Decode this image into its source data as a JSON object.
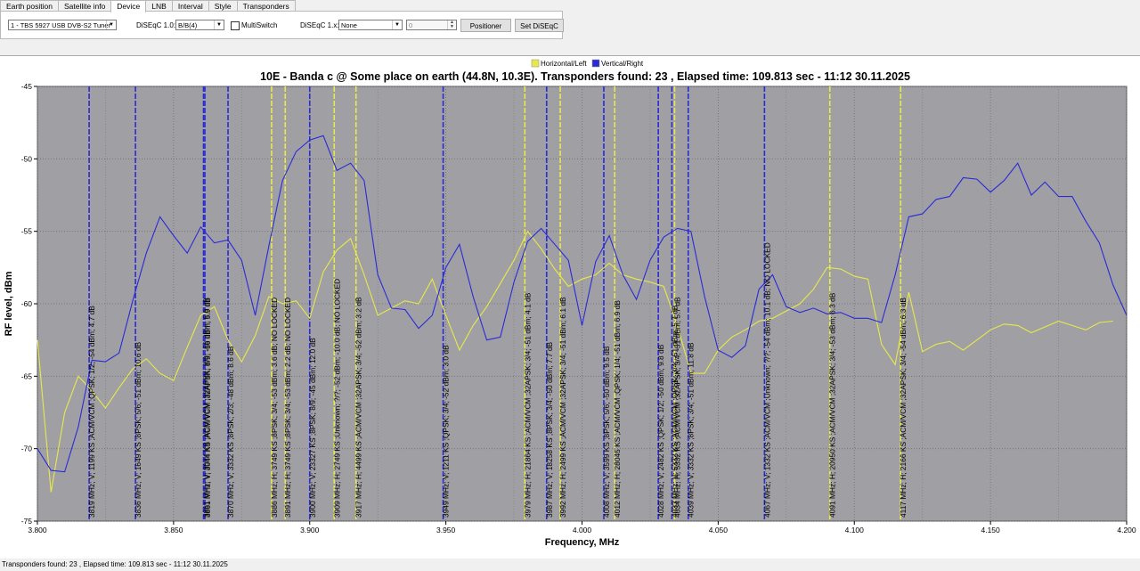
{
  "tabs": [
    {
      "label": "Earth position",
      "active": false
    },
    {
      "label": "Satellite info",
      "active": false
    },
    {
      "label": "Device",
      "active": true
    },
    {
      "label": "LNB",
      "active": false
    },
    {
      "label": "Interval",
      "active": false
    },
    {
      "label": "Style",
      "active": false
    },
    {
      "label": "Transponders",
      "active": false
    }
  ],
  "device": {
    "tuner_value": "1 - TBS 5927 USB DVB-S2 Tuner",
    "diseqc10_label": "DiSEqC 1.0:",
    "diseqc10_value": "B/B(4)",
    "multiswitch_label": "MultiSwitch",
    "diseqc1x_label": "DiSEqC 1.x:",
    "diseqc1x_value": "None",
    "spin_value": "0",
    "positioner_label": "Positioner",
    "set_diseqc_label": "Set DiSEqC"
  },
  "chart": {
    "legend_h": "Horizontal/Left",
    "legend_v": "Vertical/Right",
    "title": "10E - Banda c @ Some place on earth (44.8N, 10.3E). Transponders found: 23 , Elapsed time: 109.813 sec - 11:12 30.11.2025",
    "ylabel": "RF level, dBm",
    "xlabel": "Frequency, MHz",
    "color_h": "#e8e84a",
    "color_v": "#2a2ad8",
    "bg": "#a0a0a4"
  },
  "chart_data": {
    "type": "line",
    "title": "10E - Banda c @ Some place on earth (44.8N, 10.3E). Transponders found: 23 , Elapsed time: 109.813 sec - 11:12 30.11.2025",
    "xlabel": "Frequency, MHz",
    "ylabel": "RF level, dBm",
    "xlim": [
      3.8,
      4.2
    ],
    "ylim": [
      -75,
      -45
    ],
    "xticks": [
      "3.800",
      "3.850",
      "3.900",
      "3.950",
      "4.000",
      "4.050",
      "4.100",
      "4.150",
      "4.200"
    ],
    "yticks": [
      "-45",
      "-50",
      "-55",
      "-60",
      "-65",
      "-70",
      "-75"
    ],
    "legend": "top-right",
    "grid": true,
    "series": [
      {
        "name": "Horizontal/Left",
        "color": "#e8e84a",
        "points": [
          [
            3.8,
            -62.5
          ],
          [
            3.805,
            -73
          ],
          [
            3.81,
            -67.5
          ],
          [
            3.815,
            -65
          ],
          [
            3.82,
            -66
          ],
          [
            3.825,
            -67.2
          ],
          [
            3.83,
            -65.8
          ],
          [
            3.835,
            -64.5
          ],
          [
            3.84,
            -63.8
          ],
          [
            3.845,
            -64.8
          ],
          [
            3.85,
            -65.3
          ],
          [
            3.855,
            -63
          ],
          [
            3.86,
            -60.8
          ],
          [
            3.865,
            -60.2
          ],
          [
            3.87,
            -62.5
          ],
          [
            3.875,
            -64
          ],
          [
            3.88,
            -62.2
          ],
          [
            3.885,
            -59.5
          ],
          [
            3.89,
            -60
          ],
          [
            3.895,
            -59.8
          ],
          [
            3.9,
            -61
          ],
          [
            3.905,
            -57.8
          ],
          [
            3.91,
            -56.3
          ],
          [
            3.915,
            -55.5
          ],
          [
            3.92,
            -58
          ],
          [
            3.925,
            -60.8
          ],
          [
            3.93,
            -60.3
          ],
          [
            3.935,
            -59.8
          ],
          [
            3.94,
            -60
          ],
          [
            3.945,
            -58.3
          ],
          [
            3.95,
            -60.8
          ],
          [
            3.955,
            -63.2
          ],
          [
            3.96,
            -61.5
          ],
          [
            3.965,
            -60.2
          ],
          [
            3.97,
            -58.6
          ],
          [
            3.975,
            -57
          ],
          [
            3.98,
            -55
          ],
          [
            3.985,
            -56.2
          ],
          [
            3.99,
            -57.6
          ],
          [
            3.995,
            -58.8
          ],
          [
            4.0,
            -58.3
          ],
          [
            4.005,
            -58
          ],
          [
            4.01,
            -57.2
          ],
          [
            4.015,
            -58
          ],
          [
            4.02,
            -58.3
          ],
          [
            4.025,
            -58.5
          ],
          [
            4.03,
            -58.8
          ],
          [
            4.035,
            -61.5
          ],
          [
            4.04,
            -64.8
          ],
          [
            4.045,
            -64.8
          ],
          [
            4.05,
            -63.2
          ],
          [
            4.055,
            -62.3
          ],
          [
            4.06,
            -61.8
          ],
          [
            4.065,
            -61.2
          ],
          [
            4.07,
            -61
          ],
          [
            4.075,
            -60.5
          ],
          [
            4.08,
            -60
          ],
          [
            4.085,
            -59
          ],
          [
            4.09,
            -57.5
          ],
          [
            4.095,
            -57.6
          ],
          [
            4.1,
            -58.1
          ],
          [
            4.105,
            -58.3
          ],
          [
            4.11,
            -62.8
          ],
          [
            4.115,
            -64.2
          ],
          [
            4.12,
            -59.2
          ],
          [
            4.125,
            -63.3
          ],
          [
            4.13,
            -62.8
          ],
          [
            4.135,
            -62.6
          ],
          [
            4.14,
            -63.2
          ],
          [
            4.145,
            -62.5
          ],
          [
            4.15,
            -61.8
          ],
          [
            4.155,
            -61.4
          ],
          [
            4.16,
            -61.5
          ],
          [
            4.165,
            -62
          ],
          [
            4.17,
            -61.6
          ],
          [
            4.175,
            -61.2
          ],
          [
            4.18,
            -61.5
          ],
          [
            4.185,
            -61.8
          ],
          [
            4.19,
            -61.3
          ],
          [
            4.195,
            -61.2
          ]
        ]
      },
      {
        "name": "Vertical/Right",
        "color": "#2a2ad8",
        "points": [
          [
            3.8,
            -70
          ],
          [
            3.805,
            -71.5
          ],
          [
            3.81,
            -71.6
          ],
          [
            3.815,
            -68.5
          ],
          [
            3.82,
            -63.9
          ],
          [
            3.825,
            -64
          ],
          [
            3.83,
            -63.4
          ],
          [
            3.835,
            -59.8
          ],
          [
            3.84,
            -56.5
          ],
          [
            3.845,
            -54
          ],
          [
            3.85,
            -55.3
          ],
          [
            3.855,
            -56.5
          ],
          [
            3.86,
            -54.7
          ],
          [
            3.865,
            -55.8
          ],
          [
            3.87,
            -55.6
          ],
          [
            3.875,
            -57
          ],
          [
            3.88,
            -60.8
          ],
          [
            3.885,
            -56
          ],
          [
            3.89,
            -51.5
          ],
          [
            3.895,
            -49.5
          ],
          [
            3.9,
            -48.7
          ],
          [
            3.905,
            -48.4
          ],
          [
            3.91,
            -50.8
          ],
          [
            3.915,
            -50.3
          ],
          [
            3.92,
            -51.5
          ],
          [
            3.925,
            -58
          ],
          [
            3.93,
            -60.3
          ],
          [
            3.935,
            -60.4
          ],
          [
            3.94,
            -61.7
          ],
          [
            3.945,
            -60.8
          ],
          [
            3.95,
            -57.5
          ],
          [
            3.955,
            -55.9
          ],
          [
            3.96,
            -59.5
          ],
          [
            3.965,
            -62.5
          ],
          [
            3.97,
            -62.3
          ],
          [
            3.975,
            -58.5
          ],
          [
            3.98,
            -55.7
          ],
          [
            3.985,
            -54.8
          ],
          [
            3.99,
            -55.9
          ],
          [
            3.995,
            -57
          ],
          [
            4.0,
            -61.5
          ],
          [
            4.005,
            -57.1
          ],
          [
            4.01,
            -55.3
          ],
          [
            4.015,
            -58
          ],
          [
            4.02,
            -59.7
          ],
          [
            4.025,
            -57
          ],
          [
            4.03,
            -55.4
          ],
          [
            4.035,
            -54.8
          ],
          [
            4.04,
            -55
          ],
          [
            4.045,
            -59.5
          ],
          [
            4.05,
            -63.2
          ],
          [
            4.055,
            -63.7
          ],
          [
            4.06,
            -62.9
          ],
          [
            4.065,
            -59
          ],
          [
            4.07,
            -58
          ],
          [
            4.075,
            -60.2
          ],
          [
            4.08,
            -60.6
          ],
          [
            4.085,
            -60.3
          ],
          [
            4.09,
            -60.7
          ],
          [
            4.095,
            -60.6
          ],
          [
            4.1,
            -61
          ],
          [
            4.105,
            -61
          ],
          [
            4.11,
            -61.3
          ],
          [
            4.115,
            -58
          ],
          [
            4.12,
            -54
          ],
          [
            4.125,
            -53.8
          ],
          [
            4.13,
            -52.8
          ],
          [
            4.135,
            -52.6
          ],
          [
            4.14,
            -51.3
          ],
          [
            4.145,
            -51.4
          ],
          [
            4.15,
            -52.3
          ],
          [
            4.155,
            -51.5
          ],
          [
            4.16,
            -50.3
          ],
          [
            4.165,
            -52.5
          ],
          [
            4.17,
            -51.6
          ],
          [
            4.175,
            -52.6
          ],
          [
            4.18,
            -52.6
          ],
          [
            4.185,
            -54.3
          ],
          [
            4.19,
            -55.8
          ],
          [
            4.195,
            -58.7
          ],
          [
            4.2,
            -60.8
          ]
        ]
      }
    ],
    "transponders": [
      {
        "x": 3.819,
        "pol": "V",
        "label": "3819 MHz; V; 1199 KS ;ACM/VCM ;QPSK; 1/2; -54 dBm; 4.7 dB"
      },
      {
        "x": 3.836,
        "pol": "V",
        "label": "3836 MHz; V; 1649 KS ;8PSK; 5/6; -51 dBm; 10.6 dB"
      },
      {
        "x": 3.861,
        "pol": "V",
        "label": "3861 MHz; V; 3044 KS ;ACM/VCM ;32APSK; 8/9; -56 dBm; 5.9 dB"
      },
      {
        "x": 3.8615,
        "pol": "V",
        "label": "3861 MHz; V; 3044 KS ;ACM/VCM ;32APSK; 8/9; -56 dBm; 5.9 dB"
      },
      {
        "x": 3.87,
        "pol": "V",
        "label": "3870 MHz; V; 3332 KS ;8PSK; 2/3; -48 dBm; 8.6 dB"
      },
      {
        "x": 3.886,
        "pol": "H",
        "label": "3886 MHz; H; 3749 KS ;8PSK; 3/4; -53 dBm; 3.6 dB; NO LOCKED"
      },
      {
        "x": 3.891,
        "pol": "H",
        "label": "3891 MHz; H; 3749 KS ;8PSK; 3/4; -53 dBm; 2.2 dB; NO LOCKED"
      },
      {
        "x": 3.9,
        "pol": "V",
        "label": "3900 MHz; V; 23327 KS ;8PSK; 8/9; -45 dBm; 12.0 dB"
      },
      {
        "x": 3.909,
        "pol": "H",
        "label": "3909 MHz; H; 2749 KS ;Unknown; ?/?; -52 dBm; -10.0 dB; NO LOCKED"
      },
      {
        "x": 3.917,
        "pol": "H",
        "label": "3917 MHz; H; 4499 KS ;ACM/VCM ;32APSK; 3/4; -52 dBm; 3.2 dB"
      },
      {
        "x": 3.949,
        "pol": "V",
        "label": "3949 MHz; V; 1211 KS ;QPSK; 3/4; -52 dBm; 3.0 dB"
      },
      {
        "x": 3.979,
        "pol": "H",
        "label": "3979 MHz; H; 21864 KS ;ACM/VCM ;32APSK; 3/4; -51 dBm; 4.1 dB"
      },
      {
        "x": 3.987,
        "pol": "V",
        "label": "3987 MHz; V; 18258 KS ;8PSK; 3/4; -50 dBm; 7.7 dB"
      },
      {
        "x": 3.992,
        "pol": "H",
        "label": "3992 MHz; H; 2499 KS ;ACM/VCM ;32APSK; 3/4; -51 dBm; 6.1 dB"
      },
      {
        "x": 4.008,
        "pol": "V",
        "label": "4008 MHz; V; 3599 KS ;8PSK; 5/6; -50 dBm; 9.5 dB"
      },
      {
        "x": 4.012,
        "pol": "H",
        "label": "4012 MHz; H; 28045 KS ;ACM/VCM ;QPSK; 1/4; -51 dBm; 6.9 dB"
      },
      {
        "x": 4.028,
        "pol": "V",
        "label": "4028 MHz; V; 2482 KS ;QPSK; 1/2; -50 dBm; 9.8 dB"
      },
      {
        "x": 4.033,
        "pol": "V",
        "label": "4033 MHz; V; 5332 KS ;ACM/VCM ;QPSK; 3/4; -51 dBm; 5.7 dB"
      },
      {
        "x": 4.034,
        "pol": "H",
        "label": "4034 MHz; H; 5332 KS ;ACM/VCM ;32APSK; 3/4; -51 dBm; 5.7 dB"
      },
      {
        "x": 4.039,
        "pol": "V",
        "label": "4039 MHz; V; 3332 KS ;8PSK; 3/4; -51 dBm; 11.8 dB"
      },
      {
        "x": 4.067,
        "pol": "V",
        "label": "4067 MHz; V; 1332 KS ;ACM/VCM ;Unknown; ?/?; -54 dBm; 10.1 dB; NO LOCKED"
      },
      {
        "x": 4.091,
        "pol": "H",
        "label": "4091 MHz; H; 20950 KS ;ACM/VCM ;32APSK; 3/4; -53 dBm; 6.3 dB"
      },
      {
        "x": 4.117,
        "pol": "H",
        "label": "4117 MHz; H; 2166 KS ;ACM/VCM ;32APSK; 3/4; -54 dBm; 6.3 dB"
      }
    ]
  },
  "status": {
    "text": "Transponders found: 23 , Elapsed time: 109.813 sec - 11:12 30.11.2025"
  }
}
